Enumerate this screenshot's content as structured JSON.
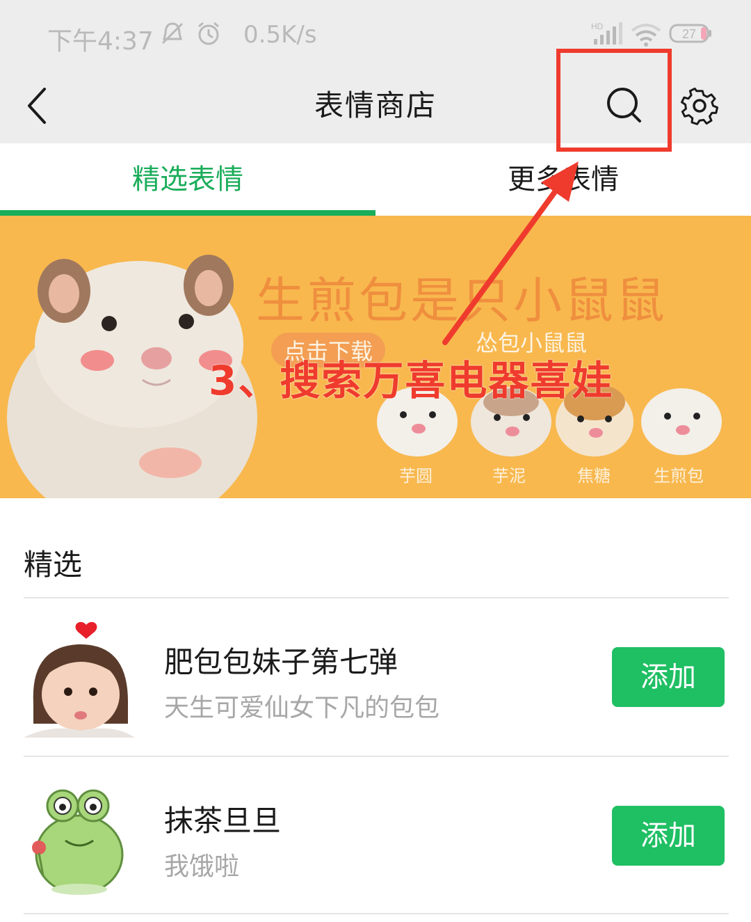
{
  "status_bar": {
    "time": "下午4:37",
    "speed": "0.5K/s",
    "signal_label": "HD",
    "battery": "27"
  },
  "nav": {
    "title": "表情商店",
    "back_icon": "chevron-left-icon",
    "search_icon": "search-icon",
    "settings_icon": "gear-icon"
  },
  "tabs": [
    {
      "label": "精选表情",
      "active": true
    },
    {
      "label": "更多表情",
      "active": false
    }
  ],
  "banner": {
    "title": "生煎包是只小鼠鼠",
    "click_text": "点击下载",
    "subtitle": "怂包小鼠鼠",
    "names": [
      "芋圆",
      "芋泥",
      "焦糖",
      "生煎包"
    ]
  },
  "annotation": {
    "text": "3、搜索万喜电器喜娃",
    "color": "#ef3b2d"
  },
  "section": {
    "title": "精选"
  },
  "items": [
    {
      "title": "肥包包妹子第七弹",
      "desc": "天生可爱仙女下凡的包包",
      "button": "添加"
    },
    {
      "title": "抹茶旦旦",
      "desc": "我饿啦",
      "button": "添加"
    }
  ],
  "colors": {
    "accent": "#1aad5a",
    "button": "#1fbf63",
    "banner_bg": "#f8b84e",
    "highlight": "#ef3b2d"
  }
}
